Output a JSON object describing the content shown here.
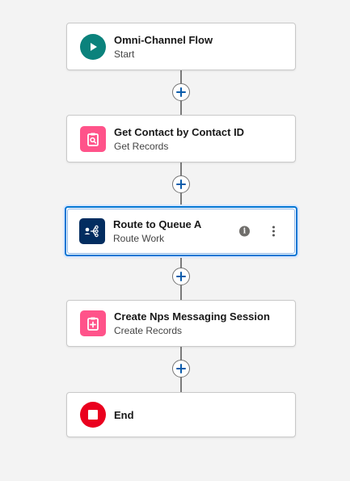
{
  "flow": {
    "nodes": [
      {
        "title": "Omni-Channel Flow",
        "subtitle": "Start",
        "icon": "play-icon",
        "icon_color": "#0b827c"
      },
      {
        "title": "Get Contact by Contact ID",
        "subtitle": "Get Records",
        "icon": "get-records-icon",
        "icon_color": "#ff538a"
      },
      {
        "title": "Route to Queue A",
        "subtitle": "Route Work",
        "icon": "route-work-icon",
        "icon_color": "#032d60"
      },
      {
        "title": "Create Nps Messaging Session",
        "subtitle": "Create Records",
        "icon": "create-records-icon",
        "icon_color": "#ff538a"
      },
      {
        "title": "End",
        "subtitle": "",
        "icon": "stop-icon",
        "icon_color": "#ea001e"
      }
    ],
    "selected_node": "Route to Queue A"
  },
  "colors": {
    "selection_border": "#0176d3",
    "connector": "#7a7a7a",
    "add_plus": "#0b5cab"
  }
}
